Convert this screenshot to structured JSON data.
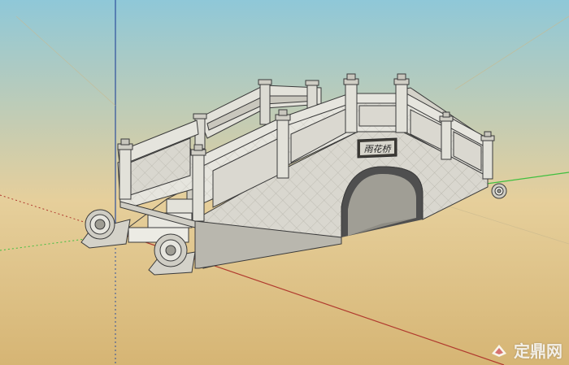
{
  "scene": {
    "sky_top": "#8fc8d8",
    "sky_bottom": "#e2c996",
    "ground": "#d8b979",
    "stone_light": "#e4e3dc",
    "stone_mid": "#cfcdc4",
    "stone_dark": "#a9a79d",
    "edge": "#3a3a3a",
    "axis_red": "#b03a2e",
    "axis_green": "#3fbf3f",
    "axis_blue": "#3050a0"
  },
  "bridge": {
    "plaque_text": "雨花桥"
  },
  "watermark": {
    "text": "定鼎网",
    "icon": "dingding-logo-icon"
  }
}
